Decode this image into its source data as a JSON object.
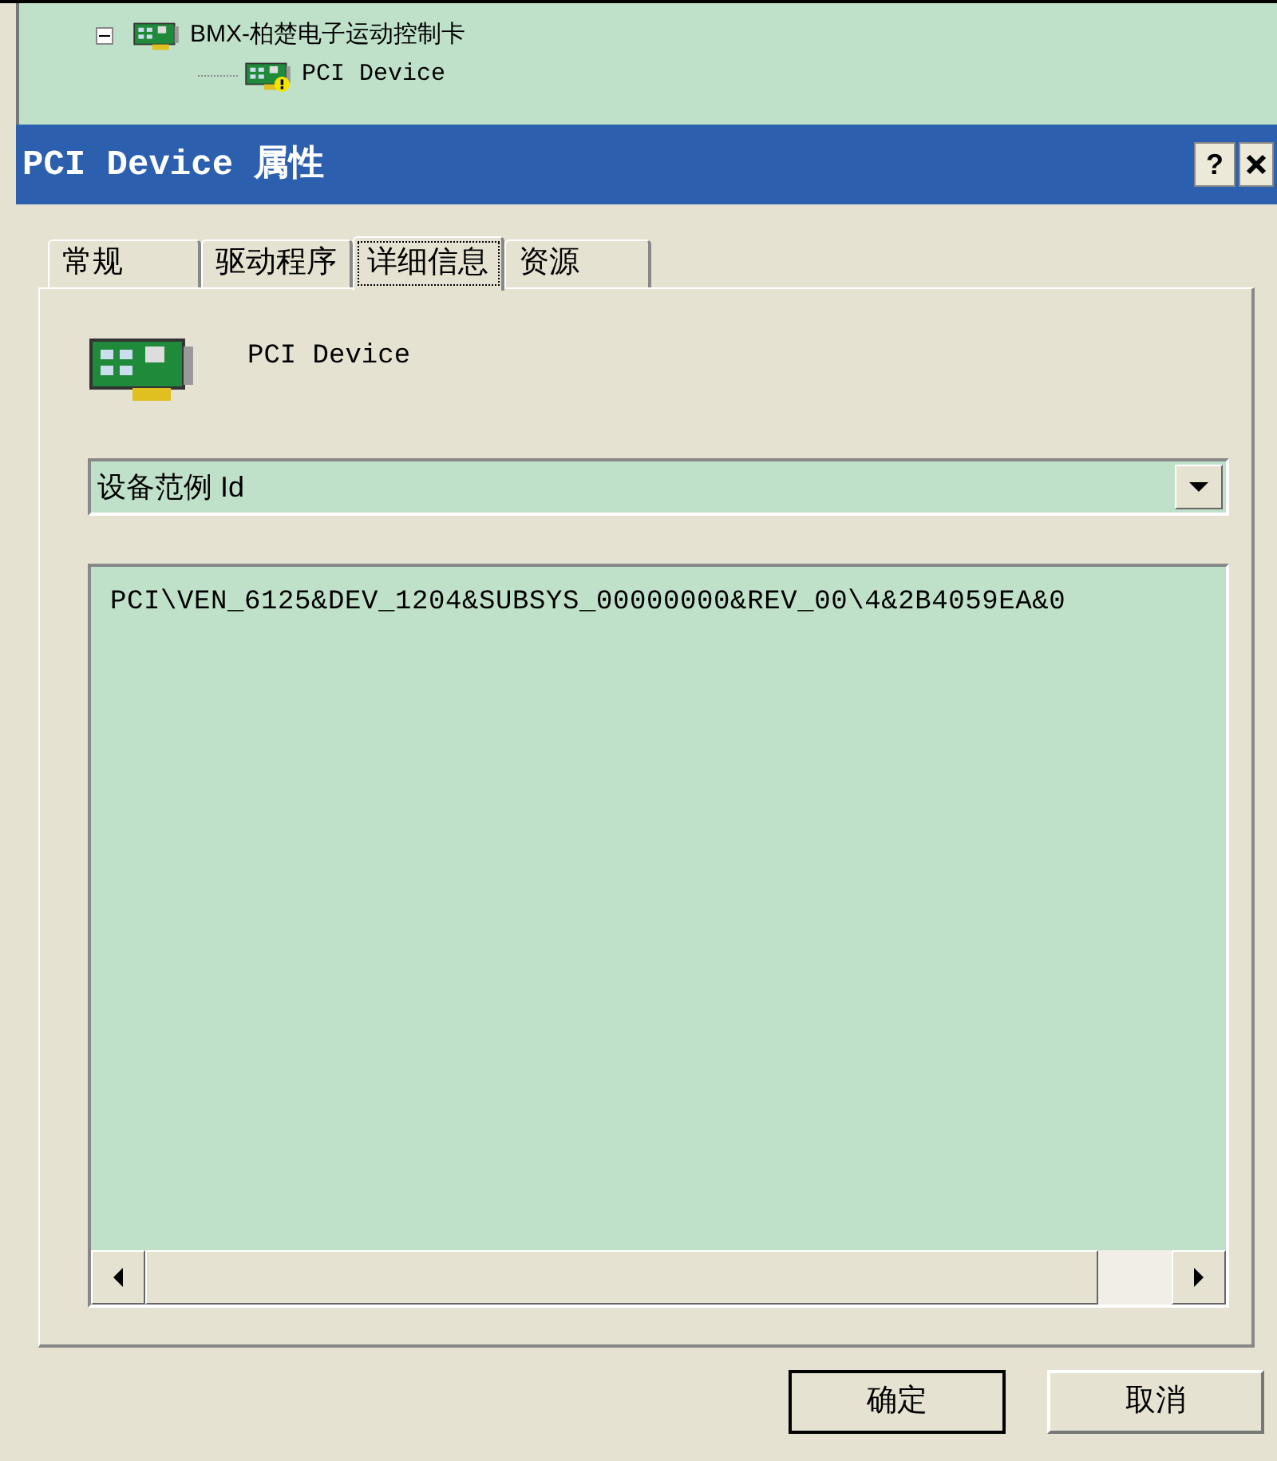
{
  "tree": {
    "items": [
      {
        "label": "BMX-柏楚电子运动控制卡",
        "expanded": true,
        "children": [
          {
            "label": "PCI Device",
            "warning": true
          }
        ]
      }
    ]
  },
  "dialog": {
    "title": "PCI Device 属性",
    "help": "?",
    "tabs": [
      {
        "label": "常规",
        "selected": false
      },
      {
        "label": "驱动程序",
        "selected": false
      },
      {
        "label": "详细信息",
        "selected": true
      },
      {
        "label": "资源",
        "selected": false
      }
    ],
    "device_name": "PCI Device",
    "property_dropdown": {
      "value": "设备范例 Id"
    },
    "values": [
      "PCI\\VEN_6125&DEV_1204&SUBSYS_00000000&REV_00\\4&2B4059EA&0"
    ],
    "buttons": [
      {
        "label": "确定",
        "default": true
      },
      {
        "label": "取消",
        "default": false
      }
    ]
  }
}
